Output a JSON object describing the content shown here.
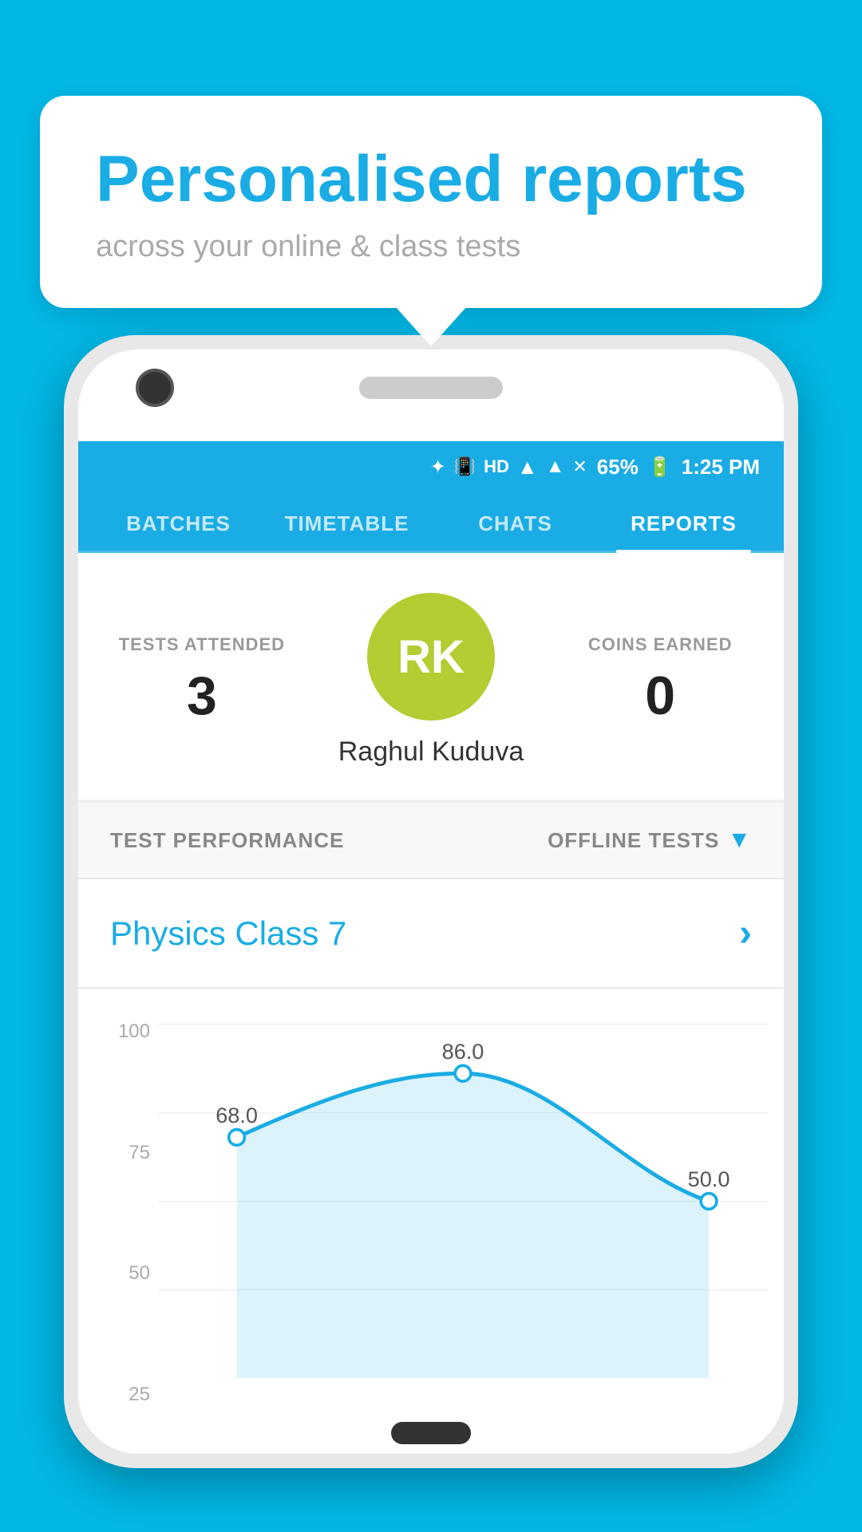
{
  "background_color": "#00B8E6",
  "tooltip": {
    "title": "Personalised reports",
    "subtitle": "across your online & class tests"
  },
  "status_bar": {
    "battery": "65%",
    "time": "1:25 PM",
    "signal_icons": "● ● ▲ ▼ ❋ HD"
  },
  "nav_tabs": [
    {
      "label": "BATCHES",
      "active": false
    },
    {
      "label": "TIMETABLE",
      "active": false
    },
    {
      "label": "CHATS",
      "active": false
    },
    {
      "label": "REPORTS",
      "active": true
    }
  ],
  "profile": {
    "tests_attended_label": "TESTS ATTENDED",
    "tests_attended_value": "3",
    "coins_earned_label": "COINS EARNED",
    "coins_earned_value": "0",
    "avatar_initials": "RK",
    "user_name": "Raghul Kuduva"
  },
  "performance": {
    "section_label": "TEST PERFORMANCE",
    "filter_label": "OFFLINE TESTS"
  },
  "class": {
    "name": "Physics Class 7"
  },
  "chart": {
    "y_labels": [
      "100",
      "75",
      "50",
      "25"
    ],
    "data_points": [
      {
        "x": 0,
        "y": 68.0,
        "label": "68.0"
      },
      {
        "x": 1,
        "y": 86.0,
        "label": "86.0"
      },
      {
        "x": 2,
        "y": 50.0,
        "label": "50.0"
      }
    ]
  },
  "colors": {
    "primary": "#1AACE4",
    "avatar_bg": "#B5CC32",
    "chart_line": "#1AACE4",
    "chart_fill": "rgba(26,172,228,0.2)"
  }
}
